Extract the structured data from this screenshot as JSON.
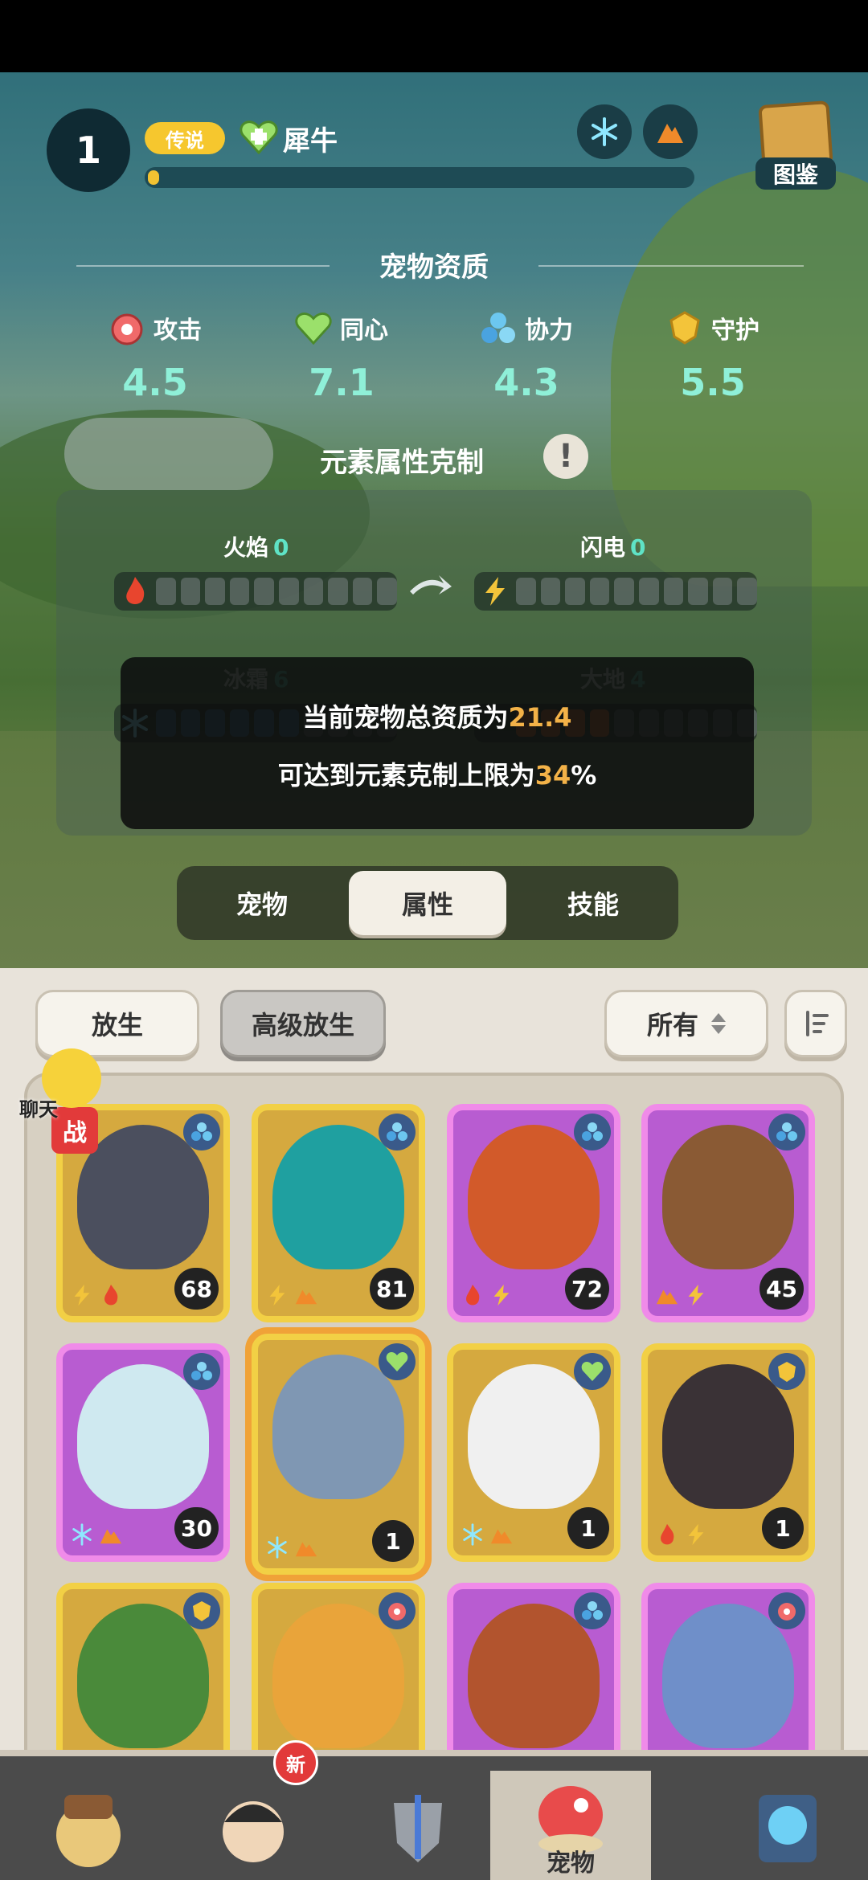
{
  "header": {
    "level": "1",
    "rarity": "传说",
    "pet_name": "犀牛",
    "xp_fraction": 0.02,
    "codex_label": "图鉴"
  },
  "aptitude": {
    "title": "宠物资质",
    "stats": [
      {
        "name": "攻击",
        "value": "4.5",
        "icon": "attack-icon"
      },
      {
        "name": "同心",
        "value": "7.1",
        "icon": "heart-icon"
      },
      {
        "name": "协力",
        "value": "4.3",
        "icon": "cooperation-icon"
      },
      {
        "name": "守护",
        "value": "5.5",
        "icon": "guard-icon"
      }
    ]
  },
  "elements": {
    "title": "元素属性克制",
    "items": [
      {
        "name": "火焰",
        "count": "0"
      },
      {
        "name": "闪电",
        "count": "0"
      },
      {
        "name": "冰霜",
        "count": "6"
      },
      {
        "name": "大地",
        "count": "4"
      }
    ]
  },
  "tooltip": {
    "line1_prefix": "当前宠物总资质为",
    "line1_value": "21.4",
    "line2_prefix": "可达到元素克制上限为",
    "line2_value": "34",
    "line2_suffix": "%"
  },
  "tabs": [
    {
      "label": "宠物",
      "active": false
    },
    {
      "label": "属性",
      "active": true
    },
    {
      "label": "技能",
      "active": false
    }
  ],
  "actions": {
    "release": "放生",
    "advanced_release": "高级放生",
    "filter": "所有"
  },
  "chat_label": "聊天",
  "battle_tag": "战",
  "pets": [
    {
      "rarity": "gold",
      "role": "cooperation",
      "level": "68",
      "elements": [
        "lightning",
        "fire"
      ],
      "color": "#4b4f5e",
      "selected": false
    },
    {
      "rarity": "gold",
      "role": "cooperation",
      "level": "81",
      "elements": [
        "lightning",
        "earth"
      ],
      "color": "#1fa0a0",
      "selected": false
    },
    {
      "rarity": "purple",
      "role": "cooperation",
      "level": "72",
      "elements": [
        "fire",
        "lightning"
      ],
      "color": "#d25a2a",
      "selected": false
    },
    {
      "rarity": "purple",
      "role": "cooperation",
      "level": "45",
      "elements": [
        "earth",
        "lightning"
      ],
      "color": "#8a5a34",
      "selected": false
    },
    {
      "rarity": "purple",
      "role": "cooperation",
      "level": "30",
      "elements": [
        "frost",
        "earth"
      ],
      "color": "#cfe9f0",
      "selected": false
    },
    {
      "rarity": "gold",
      "role": "heart",
      "level": "1",
      "elements": [
        "frost",
        "earth"
      ],
      "color": "#7f97b3",
      "selected": true
    },
    {
      "rarity": "gold",
      "role": "heart",
      "level": "1",
      "elements": [
        "frost",
        "earth"
      ],
      "color": "#f0f0f0",
      "selected": false
    },
    {
      "rarity": "gold",
      "role": "guard",
      "level": "1",
      "elements": [
        "fire",
        "lightning"
      ],
      "color": "#3a3236",
      "selected": false
    },
    {
      "rarity": "gold",
      "role": "guard",
      "level": "",
      "elements": [],
      "color": "#4a8a3a",
      "selected": false
    },
    {
      "rarity": "gold",
      "role": "attack",
      "level": "",
      "elements": [],
      "color": "#e9a43a",
      "selected": false
    },
    {
      "rarity": "purple",
      "role": "cooperation",
      "level": "",
      "elements": [],
      "color": "#b2542e",
      "selected": false
    },
    {
      "rarity": "purple",
      "role": "attack",
      "level": "",
      "elements": [],
      "color": "#6f8fc9",
      "selected": false
    }
  ],
  "nav": [
    {
      "name": "nav-tribe",
      "label": ""
    },
    {
      "name": "nav-character",
      "label": "",
      "badge": "新"
    },
    {
      "name": "nav-equipment",
      "label": ""
    },
    {
      "name": "nav-pets",
      "label": "宠物",
      "active": true
    },
    {
      "name": "nav-portal",
      "label": ""
    }
  ],
  "colors": {
    "gold_frame": "#f2d045",
    "purple_frame": "#f08be9",
    "accent_teal": "#5fe3c6",
    "highlight_orange": "#f3b248"
  }
}
